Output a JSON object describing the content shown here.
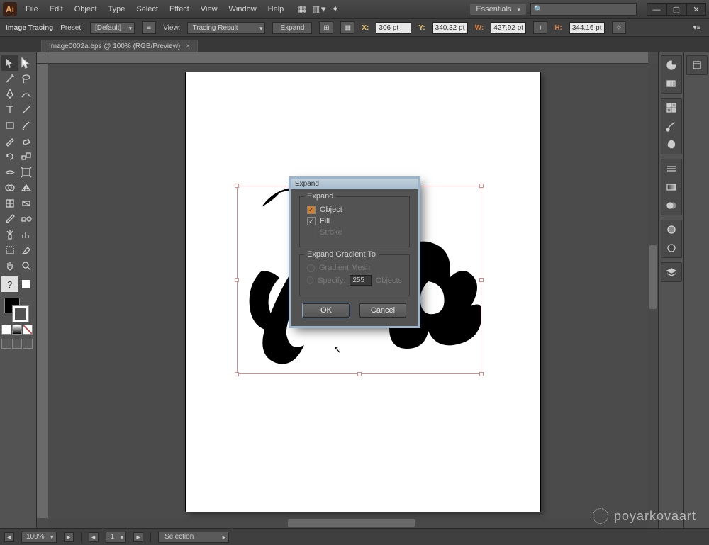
{
  "app": {
    "icon": "Ai"
  },
  "menu": [
    "File",
    "Edit",
    "Object",
    "Type",
    "Select",
    "Effect",
    "View",
    "Window",
    "Help"
  ],
  "workspace": {
    "name": "Essentials"
  },
  "window_controls": {
    "min": "—",
    "max": "▢",
    "close": "✕"
  },
  "optionsbar": {
    "label1": "Image Tracing",
    "preset_label": "Preset:",
    "preset_value": "[Default]",
    "view_label": "View:",
    "view_value": "Tracing Result",
    "expand_btn": "Expand",
    "x_label": "X:",
    "x_value": "306 pt",
    "y_label": "Y:",
    "y_value": "340,32 pt",
    "w_label": "W:",
    "w_value": "427,92 pt",
    "h_label": "H:",
    "h_value": "344,16 pt"
  },
  "tab": {
    "title": "Image0002a.eps @ 100% (RGB/Preview)"
  },
  "status": {
    "zoom": "100%",
    "page": "1",
    "tool": "Selection"
  },
  "dialog": {
    "title": "Expand",
    "group1_label": "Expand",
    "object_label": "Object",
    "fill_label": "Fill",
    "stroke_label": "Stroke",
    "group2_label": "Expand Gradient To",
    "gradmesh_label": "Gradient Mesh",
    "specify_label": "Specify:",
    "specify_value": "255",
    "specify_unit": "Objects",
    "ok": "OK",
    "cancel": "Cancel"
  },
  "watermark": "poyarkovaart"
}
